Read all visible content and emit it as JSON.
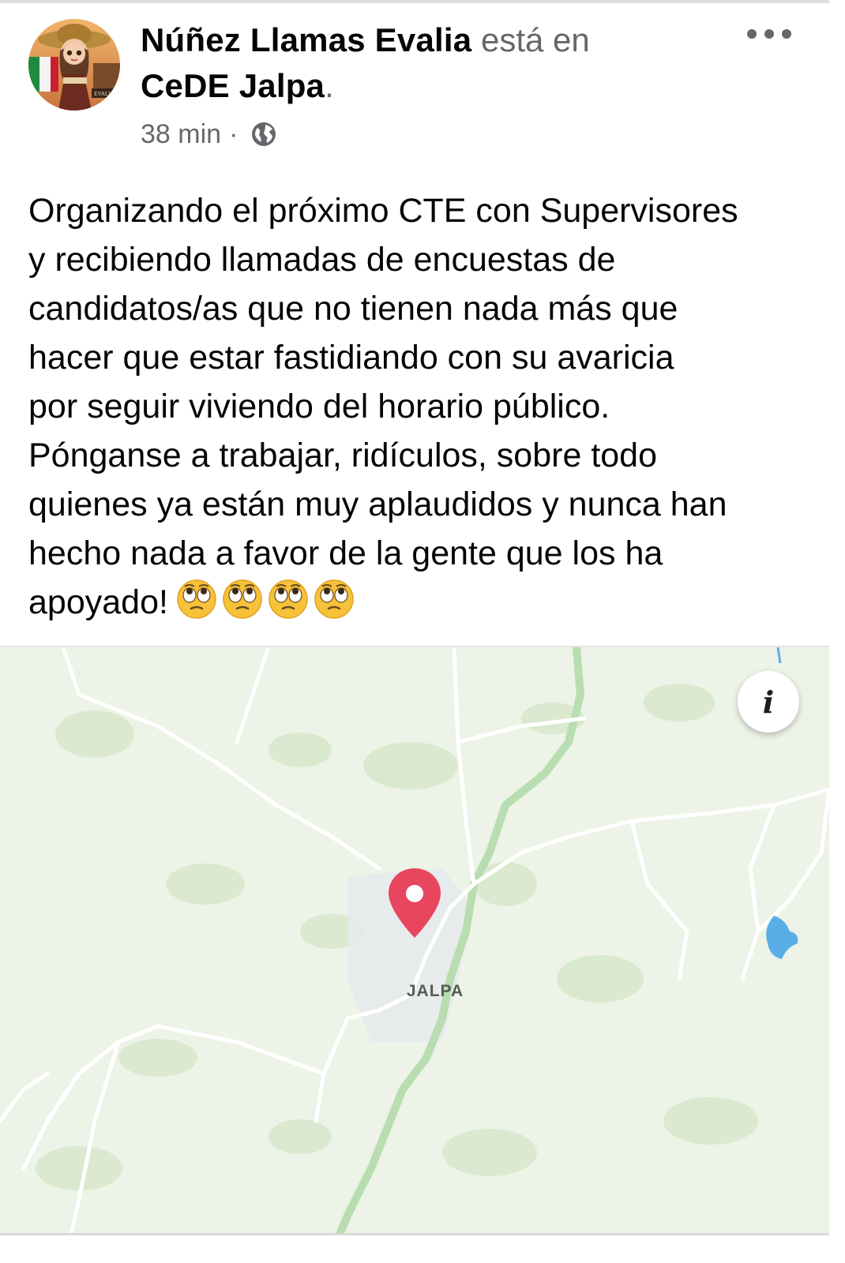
{
  "post": {
    "author": "Núñez Llamas Evalia",
    "connector": "está en",
    "place": "CeDE Jalpa",
    "place_suffix": ".",
    "time": "38 min",
    "separator": "·",
    "privacy_icon": "globe-icon",
    "menu_icon": "more-options-icon",
    "text": "Organizando el próximo CTE con Supervisores\ny recibiendo llamadas de encuestas de\ncandidatos/as que no tienen nada más que\nhacer que estar fastidiando con su avaricia\npor seguir viviendo del horario público.\nPónganse a trabajar, ridículos, sobre todo\nquienes ya están muy aplaudidos y nunca han\nhecho nada a favor de la gente que los ha\napoyado!",
    "emojis": [
      "face-with-rolling-eyes",
      "face-with-rolling-eyes",
      "face-with-rolling-eyes",
      "face-with-rolling-eyes"
    ],
    "avatar_text": "EVALIA"
  },
  "map": {
    "city_label": "JALPA",
    "info_button_label": "i",
    "pin_color": "#e8455f",
    "land_color": "#edf3e6",
    "water_color": "#5aaee8"
  }
}
